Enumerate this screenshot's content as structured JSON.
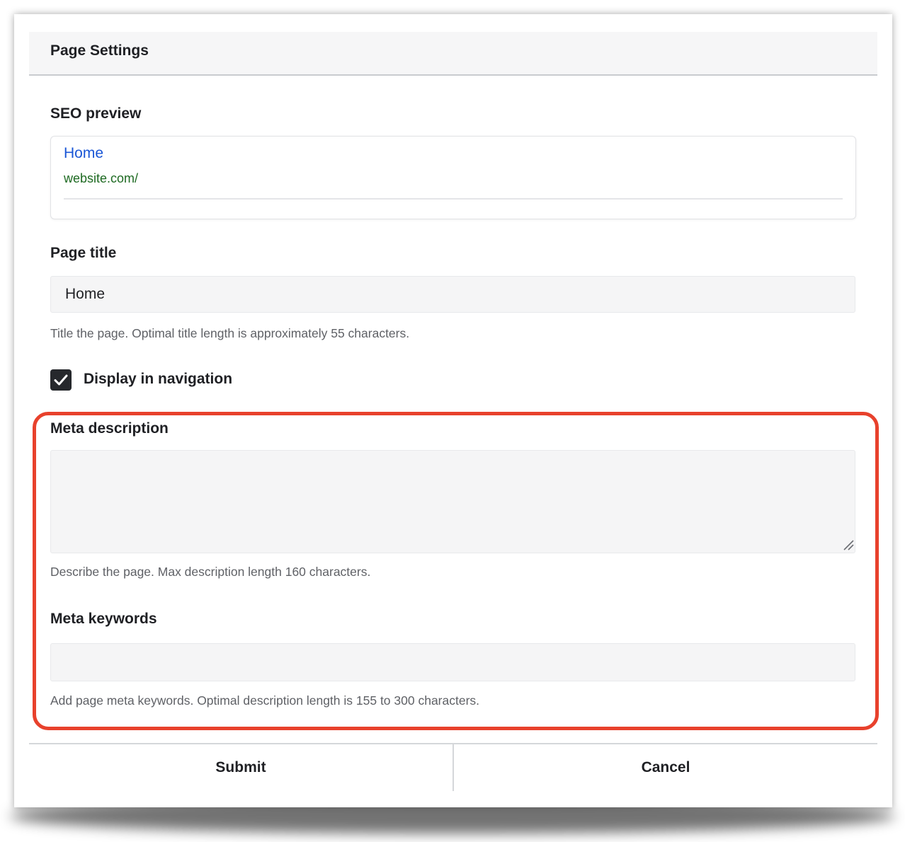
{
  "modal": {
    "title": "Page Settings"
  },
  "seo_preview": {
    "label": "SEO preview",
    "title": "Home",
    "url": "website.com/"
  },
  "page_title": {
    "label": "Page title",
    "value": "Home",
    "help": "Title the page. Optimal title length is approximately 55 characters."
  },
  "display_in_navigation": {
    "label": "Display in navigation",
    "checked": true
  },
  "meta_description": {
    "label": "Meta description",
    "value": "",
    "help": "Describe the page. Max description length 160 characters."
  },
  "meta_keywords": {
    "label": "Meta keywords",
    "value": "",
    "help": "Add page meta keywords. Optimal description length is 155 to 300 characters."
  },
  "footer": {
    "submit_label": "Submit",
    "cancel_label": "Cancel"
  },
  "colors": {
    "highlight": "#e8412c",
    "link": "#1a56d6",
    "url": "#1e6a22",
    "checkbox": "#26282c"
  },
  "icons": {
    "checkbox": "checkmark-icon",
    "resize": "resize-handle-icon"
  }
}
